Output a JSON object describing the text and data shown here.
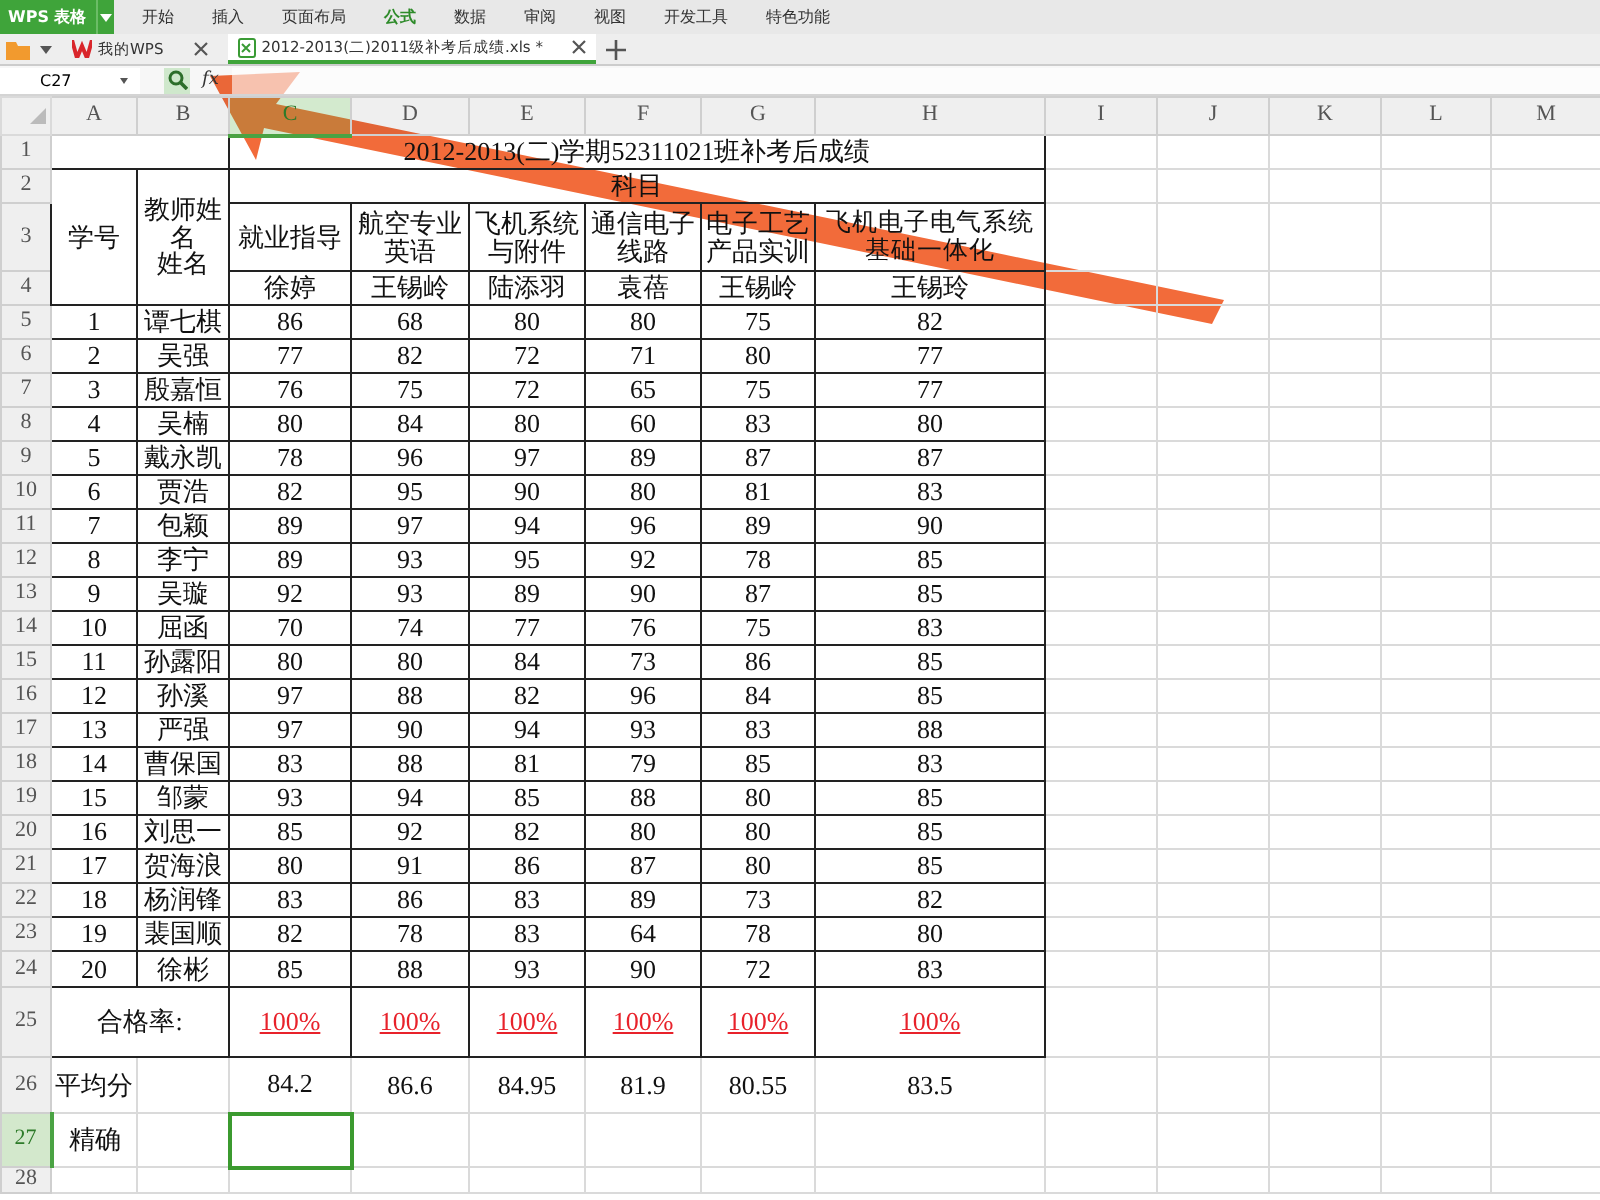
{
  "app": {
    "logo": "WPS 表格",
    "menu": [
      {
        "label": "开始",
        "selected": false
      },
      {
        "label": "插入",
        "selected": false
      },
      {
        "label": "页面布局",
        "selected": false
      },
      {
        "label": "公式",
        "selected": true
      },
      {
        "label": "数据",
        "selected": false
      },
      {
        "label": "审阅",
        "selected": false
      },
      {
        "label": "视图",
        "selected": false
      },
      {
        "label": "开发工具",
        "selected": false
      },
      {
        "label": "特色功能",
        "selected": false
      }
    ]
  },
  "tabs": [
    {
      "label": "我的WPS",
      "kind": "home",
      "selected": false
    },
    {
      "label": "2012-2013(二)2011级补考后成绩.xls *",
      "kind": "sheet",
      "selected": true
    }
  ],
  "formula_bar": {
    "cell_ref": "C27",
    "function_label": "fx"
  },
  "columns": [
    {
      "label": "A",
      "selected": false
    },
    {
      "label": "B",
      "selected": false
    },
    {
      "label": "C",
      "selected": true
    },
    {
      "label": "D",
      "selected": false
    },
    {
      "label": "E",
      "selected": false
    },
    {
      "label": "F",
      "selected": false
    },
    {
      "label": "G",
      "selected": false
    },
    {
      "label": "H",
      "selected": false
    },
    {
      "label": "I",
      "selected": false
    },
    {
      "label": "J",
      "selected": false
    },
    {
      "label": "K",
      "selected": false
    },
    {
      "label": "L",
      "selected": false
    },
    {
      "label": "M",
      "selected": false
    }
  ],
  "rows": [
    {
      "label": "1",
      "selected": false
    },
    {
      "label": "2",
      "selected": false
    },
    {
      "label": "3",
      "selected": false
    },
    {
      "label": "4",
      "selected": false
    },
    {
      "label": "5",
      "selected": false
    },
    {
      "label": "6",
      "selected": false
    },
    {
      "label": "7",
      "selected": false
    },
    {
      "label": "8",
      "selected": false
    },
    {
      "label": "9",
      "selected": false
    },
    {
      "label": "10",
      "selected": false
    },
    {
      "label": "11",
      "selected": false
    },
    {
      "label": "12",
      "selected": false
    },
    {
      "label": "13",
      "selected": false
    },
    {
      "label": "14",
      "selected": false
    },
    {
      "label": "15",
      "selected": false
    },
    {
      "label": "16",
      "selected": false
    },
    {
      "label": "17",
      "selected": false
    },
    {
      "label": "18",
      "selected": false
    },
    {
      "label": "19",
      "selected": false
    },
    {
      "label": "20",
      "selected": false
    },
    {
      "label": "21",
      "selected": false
    },
    {
      "label": "22",
      "selected": false
    },
    {
      "label": "23",
      "selected": false
    },
    {
      "label": "24",
      "selected": false
    },
    {
      "label": "25",
      "selected": false
    },
    {
      "label": "26",
      "selected": false
    },
    {
      "label": "27",
      "selected": true
    },
    {
      "label": "28",
      "selected": false
    }
  ],
  "sheet": {
    "title": "2012-2013(二)学期52311021班补考后成绩",
    "number_header": "学号",
    "teacher_header": [
      "教师姓名",
      "姓名"
    ],
    "group_header": "科目",
    "subjects": [
      "就业指导",
      "航空专业英语",
      "飞机系统与附件",
      "通信电子线路",
      "电子工艺产品实训",
      "飞机电子电气系统基础一体化"
    ],
    "teachers": [
      "徐婷",
      "王锡岭",
      "陆添羽",
      "袁蓓",
      "王锡岭",
      "王锡玲"
    ],
    "students": [
      {
        "no": "1",
        "name": "谭七棋",
        "scores": [
          "86",
          "68",
          "80",
          "80",
          "75",
          "82"
        ]
      },
      {
        "no": "2",
        "name": "吴强",
        "scores": [
          "77",
          "82",
          "72",
          "71",
          "80",
          "77"
        ]
      },
      {
        "no": "3",
        "name": "殷嘉恒",
        "scores": [
          "76",
          "75",
          "72",
          "65",
          "75",
          "77"
        ]
      },
      {
        "no": "4",
        "name": "吴楠",
        "scores": [
          "80",
          "84",
          "80",
          "60",
          "83",
          "80"
        ]
      },
      {
        "no": "5",
        "name": "戴永凯",
        "scores": [
          "78",
          "96",
          "97",
          "89",
          "87",
          "87"
        ]
      },
      {
        "no": "6",
        "name": "贾浩",
        "scores": [
          "82",
          "95",
          "90",
          "80",
          "81",
          "83"
        ]
      },
      {
        "no": "7",
        "name": "包颖",
        "scores": [
          "89",
          "97",
          "94",
          "96",
          "89",
          "90"
        ]
      },
      {
        "no": "8",
        "name": "李宁",
        "scores": [
          "89",
          "93",
          "95",
          "92",
          "78",
          "85"
        ]
      },
      {
        "no": "9",
        "name": "吴璇",
        "scores": [
          "92",
          "93",
          "89",
          "90",
          "87",
          "85"
        ]
      },
      {
        "no": "10",
        "name": "屈函",
        "scores": [
          "70",
          "74",
          "77",
          "76",
          "75",
          "83"
        ]
      },
      {
        "no": "11",
        "name": "孙露阳",
        "scores": [
          "80",
          "80",
          "84",
          "73",
          "86",
          "85"
        ]
      },
      {
        "no": "12",
        "name": "孙溪",
        "scores": [
          "97",
          "88",
          "82",
          "96",
          "84",
          "85"
        ]
      },
      {
        "no": "13",
        "name": "严强",
        "scores": [
          "97",
          "90",
          "94",
          "93",
          "83",
          "88"
        ]
      },
      {
        "no": "14",
        "name": "曹保国",
        "scores": [
          "83",
          "88",
          "81",
          "79",
          "85",
          "83"
        ]
      },
      {
        "no": "15",
        "name": "邹蒙",
        "scores": [
          "93",
          "94",
          "85",
          "88",
          "80",
          "85"
        ]
      },
      {
        "no": "16",
        "name": "刘思一",
        "scores": [
          "85",
          "92",
          "82",
          "80",
          "80",
          "85"
        ]
      },
      {
        "no": "17",
        "name": "贺海浪",
        "scores": [
          "80",
          "91",
          "86",
          "87",
          "80",
          "85"
        ]
      },
      {
        "no": "18",
        "name": "杨润锋",
        "scores": [
          "83",
          "86",
          "83",
          "89",
          "73",
          "82"
        ]
      },
      {
        "no": "19",
        "name": "裴国顺",
        "scores": [
          "82",
          "78",
          "83",
          "64",
          "78",
          "80"
        ]
      },
      {
        "no": "20",
        "name": "徐彬",
        "scores": [
          "85",
          "88",
          "93",
          "90",
          "72",
          "83"
        ]
      }
    ],
    "pass_rate": {
      "label": "合格率:",
      "values": [
        "100%",
        "100%",
        "100%",
        "100%",
        "100%",
        "100%"
      ]
    },
    "average": {
      "label": "平均分",
      "values": [
        "84.2",
        "86.6",
        "84.95",
        "81.9",
        "80.55",
        "83.5"
      ]
    },
    "precise": {
      "label": "精确",
      "active": true
    }
  }
}
